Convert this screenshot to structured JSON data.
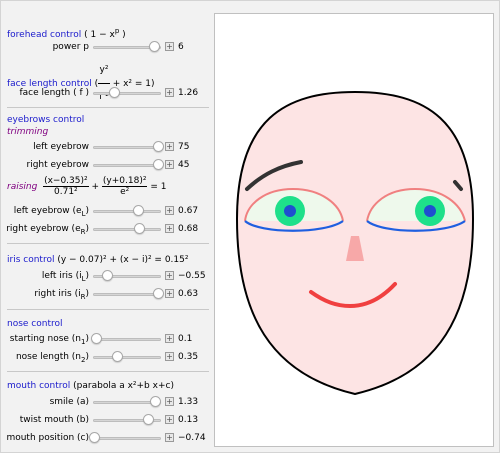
{
  "sections": {
    "forehead": {
      "title": "forehead control",
      "formula": "( 1 − x",
      "formula_sup": "p",
      "formula_end": " )"
    },
    "face_length": {
      "title": "face length control",
      "formula_num": "y²",
      "formula_den": "f ²",
      "formula_rest": "+ x² = 1)"
    },
    "eyebrows": {
      "title": "eyebrows control",
      "trimming": "trimming",
      "raising": "raising",
      "raising_num1": "(x−0.35)²",
      "raising_den1": "0.71²",
      "raising_plus": "+",
      "raising_num2": "(y+0.18)²",
      "raising_den2": "e²",
      "raising_eq": "= 1"
    },
    "iris": {
      "title": "iris control",
      "formula": "(y − 0.07)² + (x − i)² = 0.15²"
    },
    "nose": {
      "title": "nose control"
    },
    "mouth": {
      "title": "mouth control",
      "formula": "(parabola a x²+b x+c)"
    }
  },
  "controls": [
    {
      "key": "power",
      "label": "power p",
      "value": "6",
      "fraction": 0.9
    },
    {
      "key": "face_length",
      "label": "face length ( f )",
      "value": "1.26",
      "fraction": 0.32
    },
    {
      "key": "left_eyebrow",
      "label": "left eyebrow",
      "value": "75",
      "fraction": 0.97
    },
    {
      "key": "right_eyebrow",
      "label": "right eyebrow",
      "value": "45",
      "fraction": 0.97
    },
    {
      "key": "left_eyebrow_e",
      "label": "left eyebrow (e",
      "label_sub": "L",
      "label_end": ")",
      "value": "0.67",
      "fraction": 0.67
    },
    {
      "key": "right_eyebrow_e",
      "label": "right eyebrow (e",
      "label_sub": "R",
      "label_end": ")",
      "value": "0.68",
      "fraction": 0.68
    },
    {
      "key": "left_iris",
      "label": "left iris (i",
      "label_sub": "L",
      "label_end": ")",
      "value": "−0.55",
      "fraction": 0.22
    },
    {
      "key": "right_iris",
      "label": "right iris (i",
      "label_sub": "R",
      "label_end": ")",
      "value": "0.63",
      "fraction": 0.97
    },
    {
      "key": "starting_nose",
      "label": "starting nose (n",
      "label_sub": "1",
      "label_end": ")",
      "value": "0.1",
      "fraction": 0.05
    },
    {
      "key": "nose_length",
      "label": "nose length (n",
      "label_sub": "2",
      "label_end": ")",
      "value": "0.35",
      "fraction": 0.36
    },
    {
      "key": "smile",
      "label": "smile (a)",
      "value": "1.33",
      "fraction": 0.92
    },
    {
      "key": "twist_mouth",
      "label": "twist mouth (b)",
      "value": "0.13",
      "fraction": 0.82
    },
    {
      "key": "mouth_position",
      "label": "mouth position (c)",
      "value": "−0.74",
      "fraction": 0.02
    }
  ],
  "colors": {
    "face_fill": "#fde4e4",
    "face_stroke": "#000000",
    "eyebrow": "#333333",
    "eye_upper": "#f08080",
    "eye_lower": "#1f5fe0",
    "eye_white": "#eef9ec",
    "iris_outer": "#1ee08a",
    "iris_inner": "#1f4fd0",
    "nose": "#f7a8a8",
    "mouth": "#f04040"
  }
}
